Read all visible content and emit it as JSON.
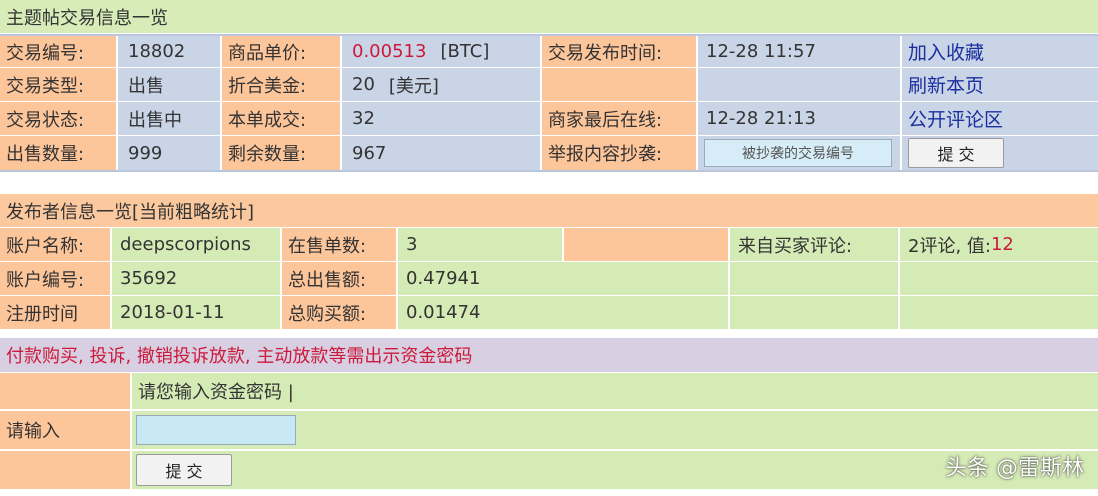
{
  "trade_section": {
    "title": "主题帖交易信息一览",
    "rows": [
      {
        "label1": "交易编号:",
        "value1": "18802",
        "label2": "商品单价:",
        "value2": "0.00513",
        "unit2": "[BTC]",
        "label3": "交易发布时间:",
        "value3": "12-28 11:57",
        "link": "加入收藏"
      },
      {
        "label1": "交易类型:",
        "value1": "出售",
        "label2": "折合美金:",
        "value2": "20",
        "unit2": "[美元]",
        "label3": "",
        "value3": "",
        "link": "刷新本页"
      },
      {
        "label1": "交易状态:",
        "value1": "出售中",
        "label2": "本单成交:",
        "value2": "32",
        "unit2": "",
        "label3": "商家最后在线:",
        "value3": "12-28 21:13",
        "link": "公开评论区"
      },
      {
        "label1": "出售数量:",
        "value1": "999",
        "label2": "剩余数量:",
        "value2": "967",
        "unit2": "",
        "label3": "举报内容抄袭:",
        "value3": "",
        "link": ""
      }
    ],
    "report_input_placeholder": "被抄袭的交易编号",
    "report_submit": "提 交"
  },
  "publisher_section": {
    "title": "发布者信息一览[当前粗略统计]",
    "rows": [
      {
        "label1": "账户名称:",
        "value1": "deepscorpions",
        "label2": "在售单数:",
        "value2": "3",
        "label3": "来自买家评论:",
        "value3": "2评论, 值:",
        "value3_num": "12"
      },
      {
        "label1": "账户编号:",
        "value1": "35692",
        "label2": "总出售额:",
        "value2": "0.47941"
      },
      {
        "label1": "注册时间",
        "value1": "2018-01-11",
        "label2": "总购买额:",
        "value2": "0.01474"
      }
    ]
  },
  "password_section": {
    "notice": "付款购买, 投诉, 撤销投诉放款, 主动放款等需出示资金密码",
    "prompt": "请您输入资金密码 |",
    "input_label": "请输入",
    "submit": "提 交"
  },
  "watermark": "头条 @雷斯林"
}
